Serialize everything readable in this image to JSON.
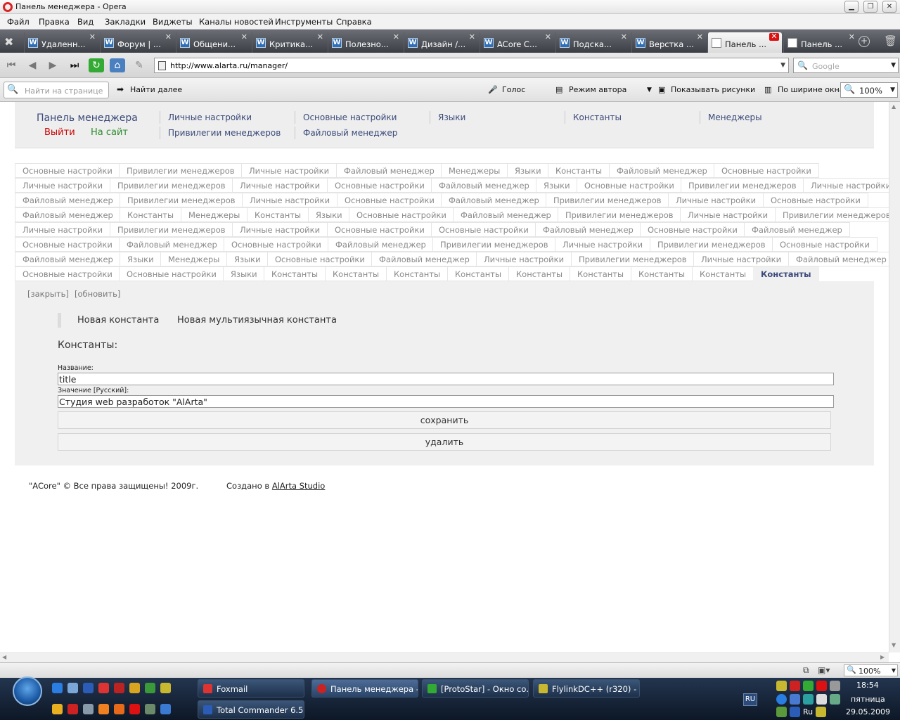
{
  "window": {
    "title": "Панель менеджера - Opera"
  },
  "menu": [
    "Файл",
    "Правка",
    "Вид",
    "Закладки",
    "Виджеты",
    "Каналы новостей",
    "Инструменты",
    "Справка"
  ],
  "browser_tabs": [
    {
      "label": "Удаленн..."
    },
    {
      "label": "Форум | ..."
    },
    {
      "label": "Общени..."
    },
    {
      "label": "Критика..."
    },
    {
      "label": "Полезно..."
    },
    {
      "label": "Дизайн /..."
    },
    {
      "label": "ACore C..."
    },
    {
      "label": "Подска..."
    },
    {
      "label": "Верстка ..."
    },
    {
      "label": "Панель ..."
    },
    {
      "label": "Панель ..."
    }
  ],
  "address": {
    "url": "http://www.alarta.ru/manager/"
  },
  "search": {
    "placeholder": "Google"
  },
  "findbar": {
    "placeholder": "Найти на странице",
    "find_next": "Найти далее",
    "voice": "Голос",
    "author_mode": "Режим автора",
    "show_images": "Показывать рисунки",
    "fit_width": "По ширине окна",
    "zoom": "100%"
  },
  "header": {
    "title": "Панель менеджера",
    "logout": "Выйти",
    "to_site": "На сайт",
    "links": [
      "Личные настройки",
      "Основные настройки",
      "Языки",
      "Константы",
      "Менеджеры",
      "Привилегии менеджеров",
      "Файловый менеджер"
    ]
  },
  "page_tabs": [
    [
      "Основные настройки",
      "Привилегии менеджеров",
      "Личные настройки",
      "Файловый менеджер",
      "Менеджеры",
      "Языки",
      "Константы",
      "Файловый менеджер",
      "Основные настройки"
    ],
    [
      "Личные настройки",
      "Привилегии менеджеров",
      "Личные настройки",
      "Основные настройки",
      "Файловый менеджер",
      "Языки",
      "Основные настройки",
      "Привилегии менеджеров",
      "Личные настройки"
    ],
    [
      "Файловый менеджер",
      "Привилегии менеджеров",
      "Личные настройки",
      "Основные настройки",
      "Файловый менеджер",
      "Привилегии менеджеров",
      "Личные настройки",
      "Основные настройки"
    ],
    [
      "Файловый менеджер",
      "Константы",
      "Менеджеры",
      "Константы",
      "Языки",
      "Основные настройки",
      "Файловый менеджер",
      "Привилегии менеджеров",
      "Личные настройки",
      "Привилегии менеджеров"
    ],
    [
      "Личные настройки",
      "Привилегии менеджеров",
      "Личные настройки",
      "Основные настройки",
      "Основные настройки",
      "Файловый менеджер",
      "Основные настройки",
      "Файловый менеджер"
    ],
    [
      "Основные настройки",
      "Файловый менеджер",
      "Основные настройки",
      "Файловый менеджер",
      "Привилегии менеджеров",
      "Личные настройки",
      "Привилегии менеджеров",
      "Основные настройки"
    ],
    [
      "Файловый менеджер",
      "Языки",
      "Менеджеры",
      "Языки",
      "Основные настройки",
      "Файловый менеджер",
      "Личные настройки",
      "Привилегии менеджеров",
      "Личные настройки",
      "Файловый менеджер"
    ],
    [
      "Основные настройки",
      "Основные настройки",
      "Языки",
      "Константы",
      "Константы",
      "Константы",
      "Константы",
      "Константы",
      "Константы",
      "Константы",
      "Константы",
      "Константы"
    ]
  ],
  "panel": {
    "close": "[закрыть]",
    "refresh": "[обновить]",
    "new_constant": "Новая константа",
    "new_multi_constant": "Новая мультиязычная константа",
    "heading": "Константы:",
    "name_label": "Название:",
    "name_value": "title",
    "value_label": "Значение [Русский]:",
    "value_value": "Студия web разработок \"AlArta\"",
    "save": "сохранить",
    "delete": "удалить"
  },
  "footer": {
    "copyright": "\"ACore\" © Все права защищены! 2009г.",
    "created_by": "Создано в ",
    "studio_link": "AlArta Studio"
  },
  "statusbar": {
    "zoom": "100%"
  },
  "taskbar": {
    "tasks_row1": [
      "Foxmail",
      "Панель менеджера -...",
      "[ProtoStar] - Окно со...",
      "FlylinkDC++ (r320) - ..."
    ],
    "tasks_row2": [
      "Total Commander 6.5..."
    ],
    "lang": "RU",
    "tray_lang": "Ru",
    "time": "18:54",
    "day": "пятница",
    "date": "29.05.2009"
  },
  "colors": {
    "accent": "#3a4a7a",
    "logout": "#cc0000",
    "to_site": "#2a8a2a"
  }
}
